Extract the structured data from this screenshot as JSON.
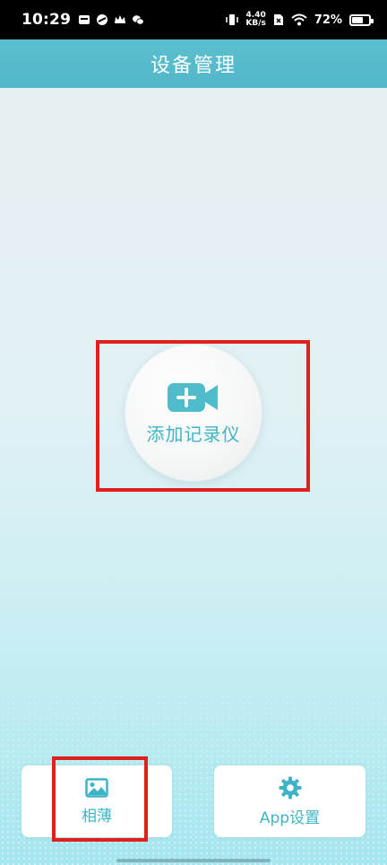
{
  "status_bar": {
    "time": "10:29",
    "speed_value": "4.40",
    "speed_unit": "KB/s",
    "battery_percent": "72%",
    "battery_level": 0.72
  },
  "header": {
    "title": "设备管理"
  },
  "main": {
    "add_recorder_label": "添加记录仪"
  },
  "bottom": {
    "album_label": "相薄",
    "settings_label": "App设置"
  },
  "colors": {
    "accent": "#3fb3c6",
    "header": "#55b9cb",
    "highlight": "#e0201f"
  },
  "icons": {
    "add_recorder": "video-camera-plus-icon",
    "album": "image-icon",
    "settings": "gear-icon"
  }
}
